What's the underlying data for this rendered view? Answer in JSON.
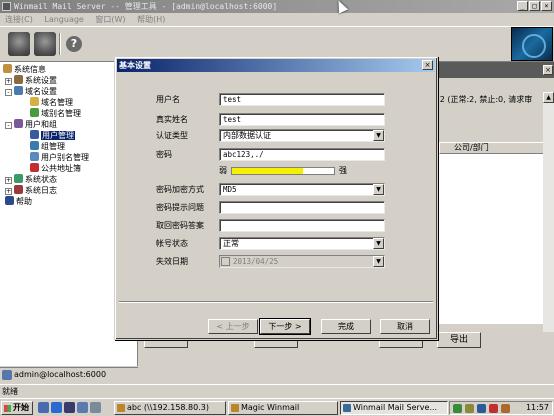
{
  "window": {
    "title": "Winmail Mail Server -- 管理工具 - [admin@localhost:6000]",
    "menu": [
      "连接(C)",
      "Language",
      "窗口(W)",
      "帮助(H)"
    ]
  },
  "tree": {
    "items": [
      {
        "label": "系统信息"
      },
      {
        "label": "系统设置"
      },
      {
        "label": "域名设置"
      },
      {
        "label": "域名管理"
      },
      {
        "label": "域别名管理"
      },
      {
        "label": "用户和组"
      },
      {
        "label": "用户管理"
      },
      {
        "label": "组管理"
      },
      {
        "label": "用户别名管理"
      },
      {
        "label": "公共地址簿"
      },
      {
        "label": "系统状态"
      },
      {
        "label": "系统日志"
      },
      {
        "label": "帮助"
      }
    ]
  },
  "right_panel": {
    "summary": ":2 (正常:2, 禁止:0, 请求审",
    "column_header": "公司/部门",
    "export_button": "导出"
  },
  "dialog": {
    "title": "基本设置",
    "fields": {
      "username": {
        "label": "用户名",
        "value": "test"
      },
      "realname": {
        "label": "真实姓名",
        "value": "test"
      },
      "auth_type": {
        "label": "认证类型",
        "value": "内部数据认证"
      },
      "password": {
        "label": "密码",
        "value": "abc123,./"
      },
      "strength": {
        "weak": "弱",
        "strong": "强",
        "level": 0.7
      },
      "encrypt": {
        "label": "密码加密方式",
        "value": "MD5"
      },
      "hint_q": {
        "label": "密码提示问题",
        "value": ""
      },
      "hint_a": {
        "label": "取回密码答案",
        "value": ""
      },
      "account_status": {
        "label": "帐号状态",
        "value": "正常"
      },
      "expire_date": {
        "label": "失效日期",
        "value": "2013/04/25"
      }
    },
    "buttons": {
      "back": "< 上一步",
      "next": "下一步 >",
      "finish": "完成",
      "cancel": "取消"
    }
  },
  "status": {
    "connection": "admin@localhost:6000",
    "ready": "就绪"
  },
  "taskbar": {
    "start": "开始",
    "tasks": [
      "abc (\\\\192.158.80.3)",
      "Magic Winmail",
      "Winmail Mail Serve..."
    ],
    "clock": "11:57"
  }
}
